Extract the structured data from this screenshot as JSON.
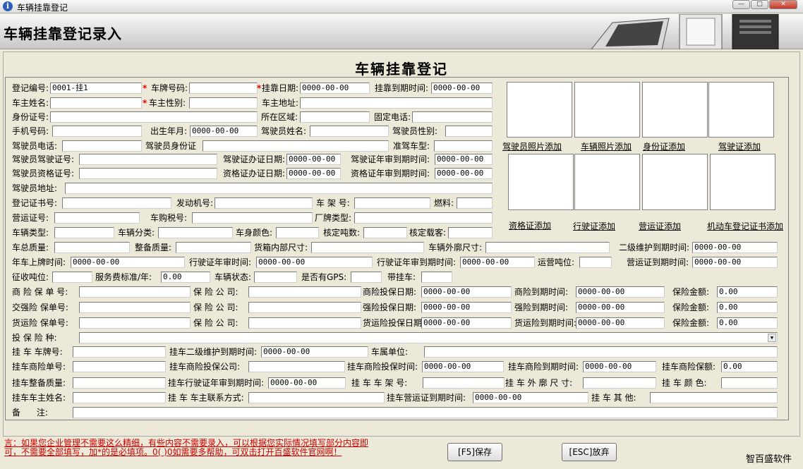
{
  "window": {
    "title": "车辆挂靠登记",
    "minimize": "—",
    "maximize": "□",
    "close": "✕"
  },
  "header": {
    "title": "车辆挂靠登记录入"
  },
  "form": {
    "title": "车辆挂靠登记",
    "reg_no_label": "登记编号:",
    "reg_no": "0001-挂1",
    "plate_label": "车牌号码:",
    "attach_date_label": "挂靠日期:",
    "attach_date": "0000-00-00",
    "attach_expire_label": "挂靠到期时间:",
    "attach_expire": "0000-00-00",
    "owner_name_label": "车主姓名:",
    "owner_gender_label": "车主性别:",
    "owner_addr_label": "车主地址:",
    "id_no_label": "身份证号:",
    "region_label": "所在区域:",
    "phone_label": "固定电话:",
    "mobile_label": "手机号码:",
    "birth_label": "出生年月:",
    "birth": "0000-00-00",
    "driver_name_label": "驾驶员姓名:",
    "driver_gender_label": "驾驶员性别:",
    "driver_phone_label": "驾驶员电话:",
    "driver_id_label": "驾驶员身份证",
    "vehicle_type_allowed_label": "准驾车型:",
    "driver_license_label": "驾驶员驾驶证号:",
    "license_issue_label": "驾驶证办证日期:",
    "license_issue": "0000-00-00",
    "license_exp_label": "驾驶证年审到期时间:",
    "license_exp": "0000-00-00",
    "qual_no_label": "驾驶员资格证号:",
    "qual_issue_label": "资格证办证日期:",
    "qual_issue": "0000-00-00",
    "qual_exp_label": "资格证年审到期时间:",
    "qual_exp": "0000-00-00",
    "driver_addr_label": "驾驶员地址:",
    "reg_cert_label": "登记证书号:",
    "engine_label": "发动机号:",
    "frame_label": "车 架 号:",
    "fuel_label": "燃料:",
    "op_cert_label": "营运证号:",
    "tax_label": "车购税号:",
    "brand_label": "厂牌类型:",
    "vtype_label": "车辆类型:",
    "vclass_label": "车辆分类:",
    "color_label": "车身颜色:",
    "tonnage_label": "核定吨数:",
    "passengers_label": "核定载客:",
    "gross_label": "车总质量:",
    "curb_label": "整备质量:",
    "box_label": "货箱内部尺寸:",
    "outer_label": "车辆外廓尺寸:",
    "maint_label": "二级维护到期时间:",
    "maint": "0000-00-00",
    "onboard_label": "年车上牌时间:",
    "onboard": "0000-00-00",
    "drv_review_label": "行驶证年审时间:",
    "drv_review": "0000-00-00",
    "drv_review_exp_label": "行驶证年审到期时间:",
    "drv_review_exp": "0000-00-00",
    "op_ton_label": "运营吨位:",
    "op_cert_exp_label": "营运证到期时间:",
    "op_cert_exp": "0000-00-00",
    "levy_label": "征收吨位:",
    "fee_label": "服务费标准/年:",
    "fee": "0.00",
    "status_label": "车辆状态:",
    "gps_label": "是否有GPS:",
    "trailer_label": "带挂车:",
    "comm_ins_label": "商 险 保 单 号:",
    "ins_co_label": "保 险 公 司:",
    "comm_date_label": "商险投保日期:",
    "comm_date": "0000-00-00",
    "comm_exp_label": "商险到期时间:",
    "comm_exp": "0000-00-00",
    "amount_label": "保险金额:",
    "amount": "0.00",
    "cmp_ins_label": "交强险 保单号:",
    "cmp_date_label": "强险投保日期:",
    "cmp_date": "0000-00-00",
    "cmp_exp_label": "强险到期时间:",
    "cmp_exp": "0000-00-00",
    "cargo_ins_label": "货运险 保单号:",
    "cargo_date_label": "货运险投保日期",
    "cargo_date": "0000-00-00",
    "cargo_exp_label": "货运险到期时间:",
    "cargo_exp": "0000-00-00",
    "ins_type_label": "投 保 险 种:",
    "tr_plate_label": "挂 车 车牌号:",
    "tr_maint_label": "挂车二级维护到期时间:",
    "tr_maint": "0000-00-00",
    "tr_owner_unit_label": "车属单位:",
    "tr_comm_no_label": "挂车商险单号:",
    "tr_comm_co_label": "挂车商险投保公司:",
    "tr_comm_date_label": "挂车商险投保时间:",
    "tr_comm_date": "0000-00-00",
    "tr_comm_exp_label": "挂车商险到期时间:",
    "tr_comm_exp": "0000-00-00",
    "tr_premium_label": "挂车商险保额:",
    "tr_premium": "0.00",
    "tr_curb_label": "挂车整备质量:",
    "tr_review_label": "挂车行驶证年审到期时间:",
    "tr_review": "0000-00-00",
    "tr_frame_label": "挂 车 车 架 号:",
    "tr_outer_label": "挂 车 外 廓 尺 寸:",
    "tr_color_label": "挂 车 颜 色:",
    "tr_owner_label": "挂车车主姓名:",
    "tr_contact_label": "挂 车 车主联系方式:",
    "tr_opcert_label": "挂车营运证到期时间:",
    "tr_opcert": "0000-00-00",
    "tr_other_label": "挂 车 其 他:",
    "remark_label": "备      注:"
  },
  "photos": {
    "row1": [
      "驾驶员照片添加",
      "车辆照片添加",
      "身份证添加",
      "驾驶证添加"
    ],
    "row2": [
      "资格证添加",
      "行驶证添加",
      "营运证添加",
      "机动车登记证书添加"
    ]
  },
  "footer": {
    "note1": "言：如果您企业管理不需要这么精细，有些内容不需要录入，可以根据您实际情况填写部分内容即",
    "note2": "可，不需要全部填写，加*的是必填项。0(     )0如需要多帮助，可双击打开百盛软件官网啊！",
    "save": "[F5]保存",
    "cancel": "[ESC]放弃",
    "brand": "智百盛软件"
  }
}
